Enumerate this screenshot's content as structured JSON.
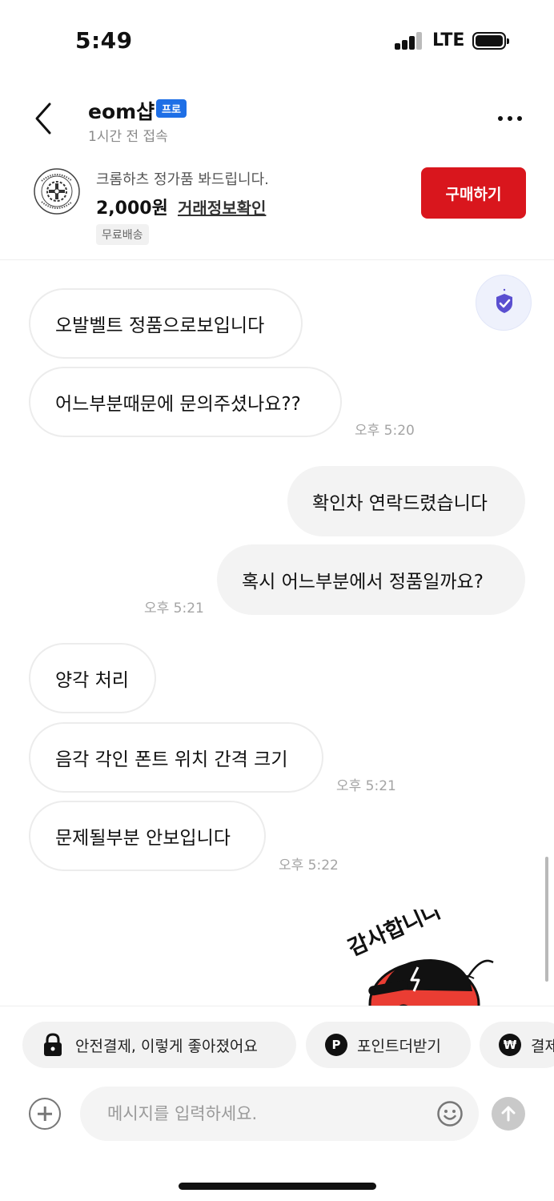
{
  "status_bar": {
    "time": "5:49",
    "network": "LTE",
    "battery_level": 1.0
  },
  "header": {
    "shop_name": "eom샵",
    "pro_badge": "프로",
    "last_seen": "1시간 전 접속"
  },
  "product": {
    "title": "크롬하츠 정가품 봐드립니다.",
    "price": "2,000원",
    "deal_info_link": "거래정보확인",
    "shipping_tag": "무료배송",
    "buy_button": "구매하기",
    "thumbnail_icon": "chrome-hearts-logo-icon"
  },
  "colors": {
    "accent": "#d9161d",
    "pro_badge": "#1e6fe6",
    "shield": "#5a4fd0"
  },
  "messages": [
    {
      "direction": "in",
      "text": "오발벨트 정품으로보입니다"
    },
    {
      "direction": "in",
      "text": "어느부분때문에 문의주셨나요??",
      "time": "오후 5:20"
    },
    {
      "direction": "out",
      "text": "확인차 연락드렸습니다"
    },
    {
      "direction": "out",
      "text": "혹시 어느부분에서 정품일까요?",
      "time": "오후 5:21"
    },
    {
      "direction": "in",
      "text": "양각 처리"
    },
    {
      "direction": "in",
      "text": "음각 각인 폰트 위치 간격 크기",
      "time": "오후 5:21"
    },
    {
      "direction": "in",
      "text": "문제될부분 안보입니다",
      "time": "오후 5:22"
    }
  ],
  "sticker": {
    "text": "감사합니다",
    "icon": "thank-you-sticker"
  },
  "quick_actions": [
    {
      "label": "안전결제, 이렇게 좋아졌어요",
      "icon": "lock-icon"
    },
    {
      "label": "포인트더받기",
      "icon": "point-icon",
      "icon_glyph": "P"
    },
    {
      "label": "결제",
      "icon": "won-icon",
      "icon_glyph": "₩"
    }
  ],
  "input": {
    "placeholder": "메시지를 입력하세요."
  }
}
